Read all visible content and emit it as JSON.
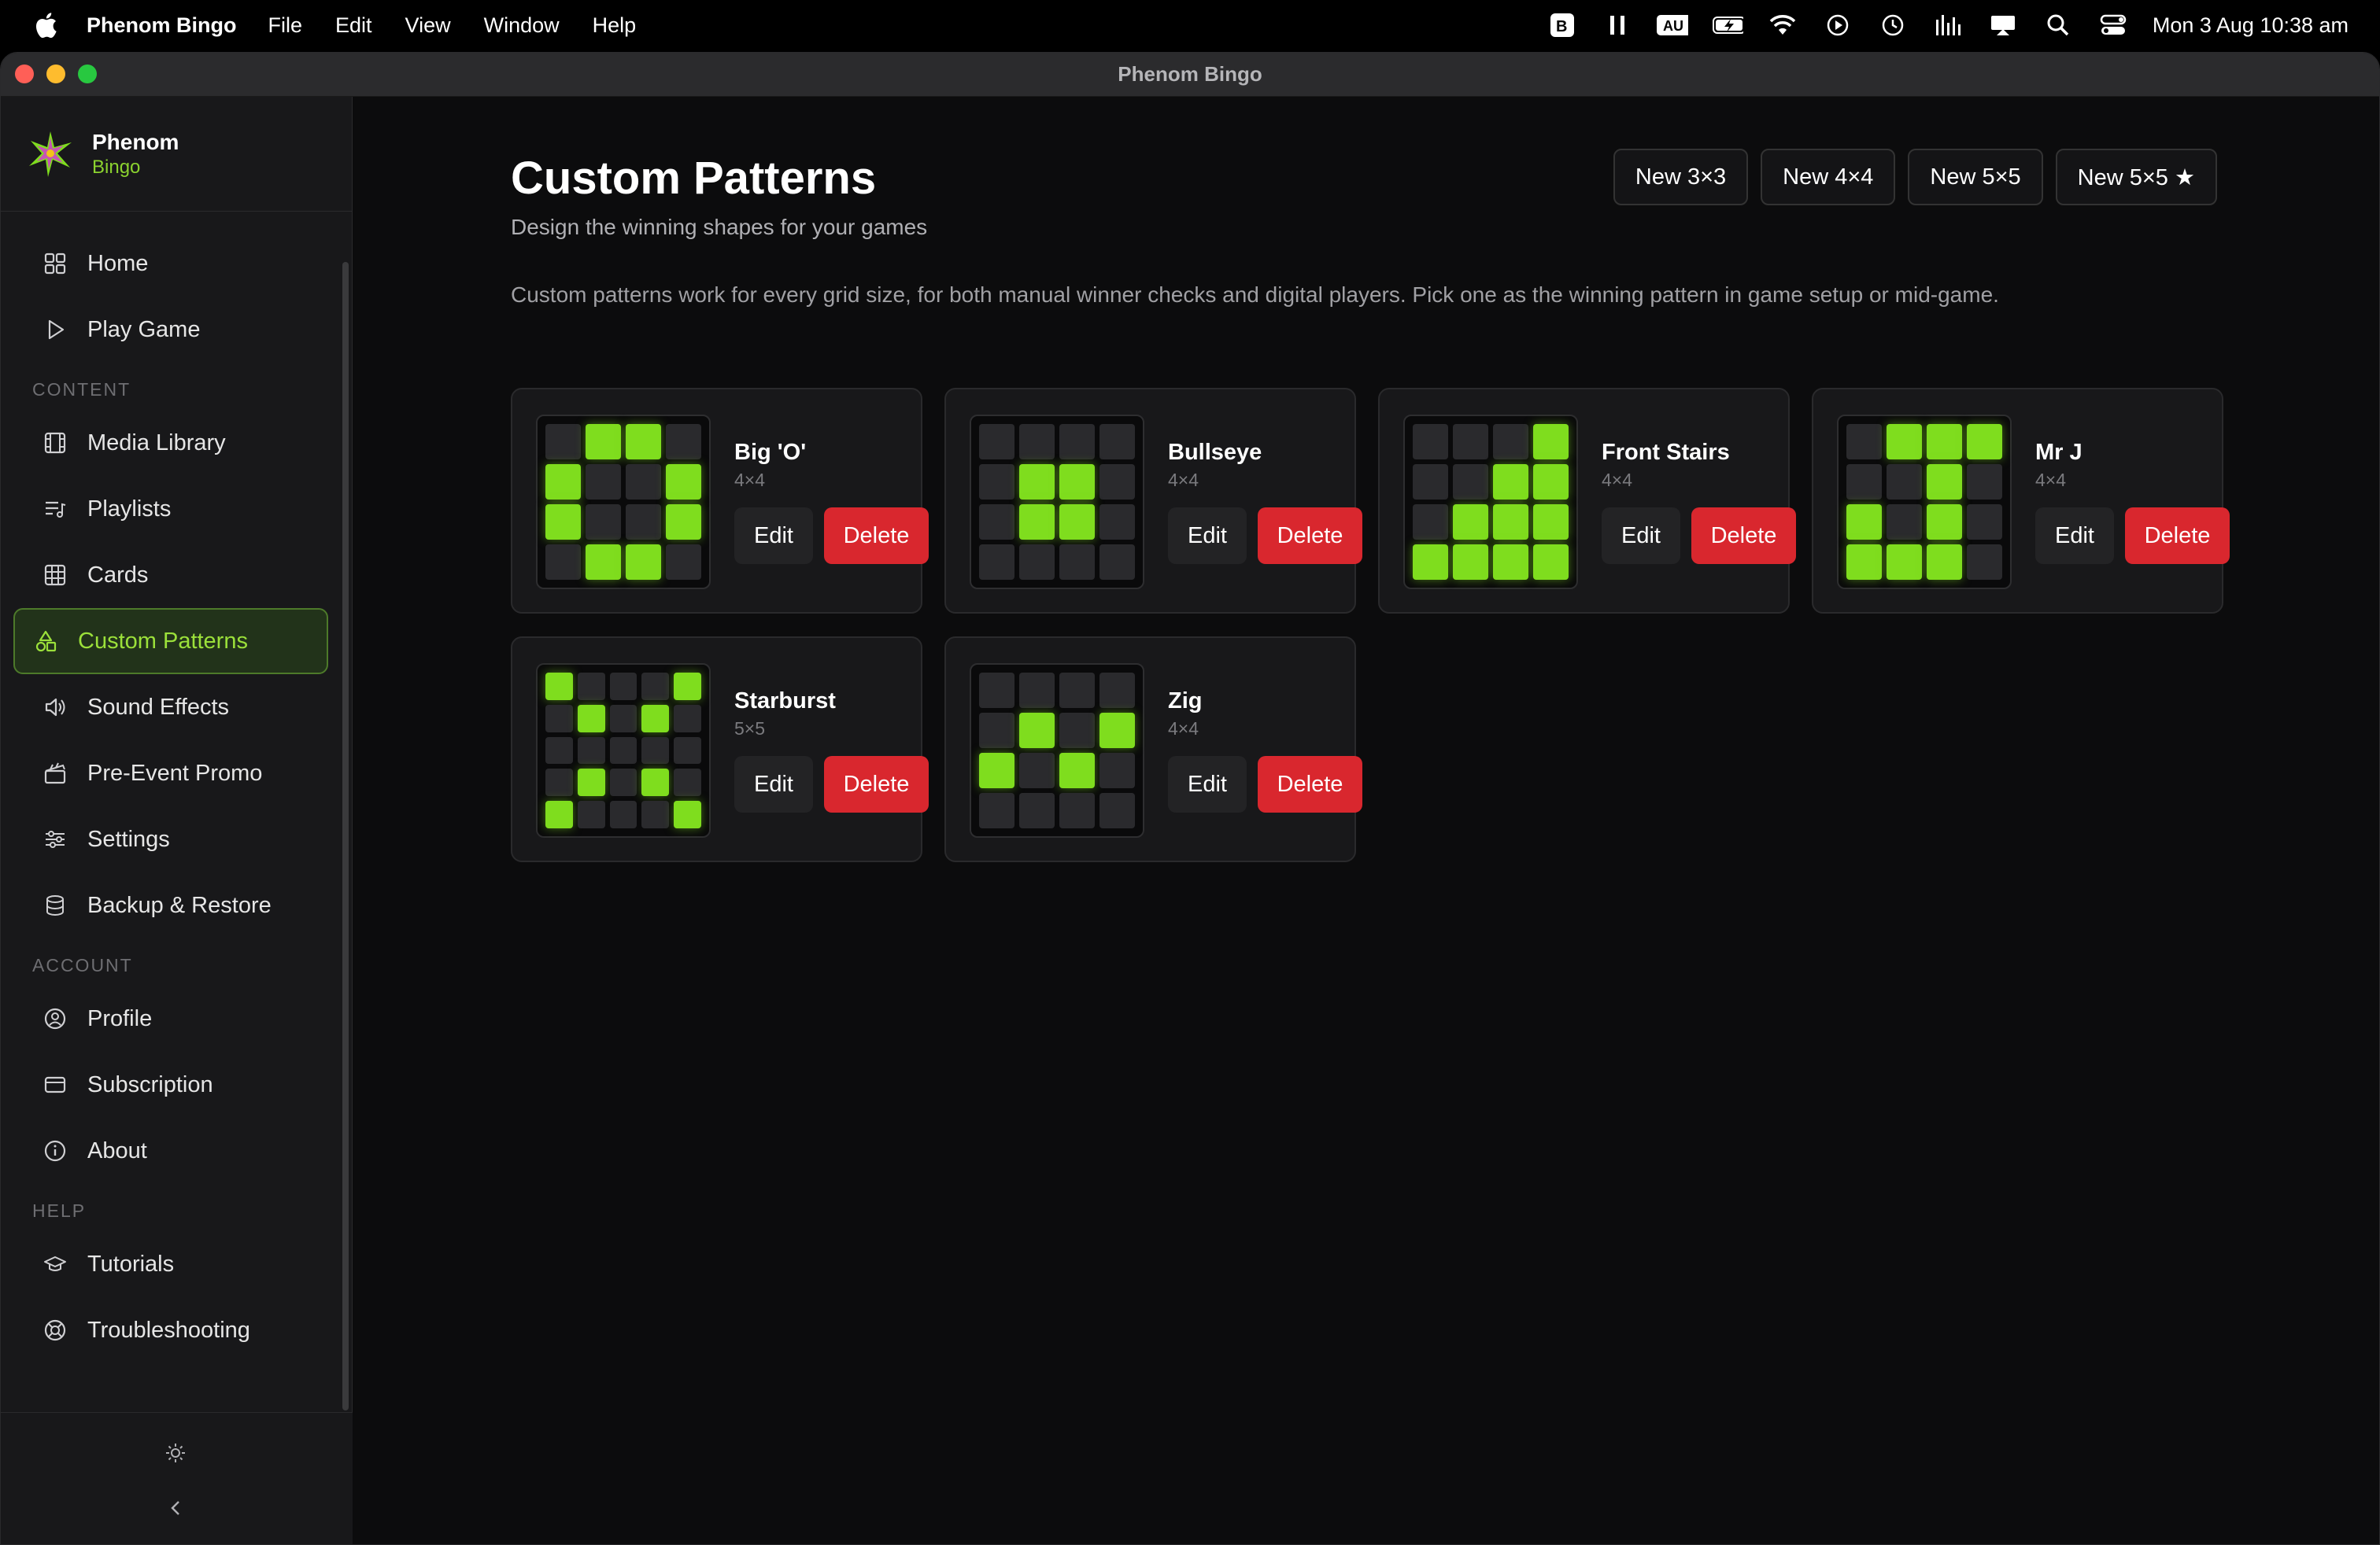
{
  "menubar": {
    "app_name": "Phenom Bingo",
    "menus": [
      "File",
      "Edit",
      "View",
      "Window",
      "Help"
    ],
    "status_icons": [
      "bbedit-icon",
      "pause-icon",
      "au-badge",
      "battery-icon",
      "wifi-icon",
      "play-circle-icon",
      "time-machine-icon",
      "audio-levels-icon",
      "screen-mirror-icon",
      "spotlight-icon",
      "control-center-icon"
    ],
    "au_label": "AU",
    "clock": "Mon 3 Aug  10:38 am"
  },
  "window": {
    "title": "Phenom Bingo",
    "traffic_lights": {
      "close": "#ff5f57",
      "minimize": "#febc2e",
      "zoom": "#28c840"
    }
  },
  "sidebar": {
    "brand": {
      "name": "Phenom",
      "sub": "Bingo"
    },
    "items": [
      {
        "label": "Home",
        "icon": "grid-icon"
      },
      {
        "label": "Play Game",
        "icon": "play-icon"
      }
    ],
    "sections": [
      {
        "title": "CONTENT",
        "items": [
          {
            "label": "Media Library",
            "icon": "film-icon"
          },
          {
            "label": "Playlists",
            "icon": "playlist-icon"
          },
          {
            "label": "Cards",
            "icon": "table-icon"
          },
          {
            "label": "Custom Patterns",
            "icon": "shapes-icon",
            "active": true
          },
          {
            "label": "Sound Effects",
            "icon": "speaker-icon"
          },
          {
            "label": "Pre-Event Promo",
            "icon": "clapperboard-icon"
          },
          {
            "label": "Settings",
            "icon": "sliders-icon"
          },
          {
            "label": "Backup & Restore",
            "icon": "database-icon"
          }
        ]
      },
      {
        "title": "ACCOUNT",
        "items": [
          {
            "label": "Profile",
            "icon": "user-circle-icon"
          },
          {
            "label": "Subscription",
            "icon": "credit-card-icon"
          },
          {
            "label": "About",
            "icon": "info-icon"
          }
        ]
      },
      {
        "title": "HELP",
        "items": [
          {
            "label": "Tutorials",
            "icon": "graduation-cap-icon"
          },
          {
            "label": "Troubleshooting",
            "icon": "lifebuoy-icon"
          }
        ]
      }
    ],
    "accent": "#8bd22f"
  },
  "main": {
    "title": "Custom Patterns",
    "subtitle": "Design the winning shapes for your games",
    "intro": "Custom patterns work for every grid size, for both manual winner checks and digital players. Pick one as the winning pattern in game setup or mid-game.",
    "new_buttons": [
      "New 3×3",
      "New 4×4",
      "New 5×5",
      "New 5×5 ★"
    ],
    "edit_label": "Edit",
    "delete_label": "Delete",
    "patterns": [
      {
        "name": "Big 'O'",
        "size": "4×4",
        "n": 4,
        "cells": [
          0,
          1,
          1,
          0,
          1,
          0,
          0,
          1,
          1,
          0,
          0,
          1,
          0,
          1,
          1,
          0
        ]
      },
      {
        "name": "Bullseye",
        "size": "4×4",
        "n": 4,
        "cells": [
          0,
          0,
          0,
          0,
          0,
          1,
          1,
          0,
          0,
          1,
          1,
          0,
          0,
          0,
          0,
          0
        ]
      },
      {
        "name": "Front Stairs",
        "size": "4×4",
        "n": 4,
        "cells": [
          0,
          0,
          0,
          1,
          0,
          0,
          1,
          1,
          0,
          1,
          1,
          1,
          1,
          1,
          1,
          1
        ]
      },
      {
        "name": "Mr J",
        "size": "4×4",
        "n": 4,
        "cells": [
          0,
          1,
          1,
          1,
          0,
          0,
          1,
          0,
          1,
          0,
          1,
          0,
          1,
          1,
          1,
          0
        ]
      },
      {
        "name": "Starburst",
        "size": "5×5",
        "n": 5,
        "cells": [
          1,
          0,
          0,
          0,
          1,
          0,
          1,
          0,
          1,
          0,
          0,
          0,
          0,
          0,
          0,
          0,
          1,
          0,
          1,
          0,
          1,
          0,
          0,
          0,
          1
        ]
      },
      {
        "name": "Zig",
        "size": "4×4",
        "n": 4,
        "cells": [
          0,
          0,
          0,
          0,
          0,
          1,
          0,
          1,
          1,
          0,
          1,
          0,
          0,
          0,
          0,
          0
        ]
      }
    ],
    "colors": {
      "cell_on": "#7fdd1e",
      "delete": "#d9272e"
    }
  }
}
